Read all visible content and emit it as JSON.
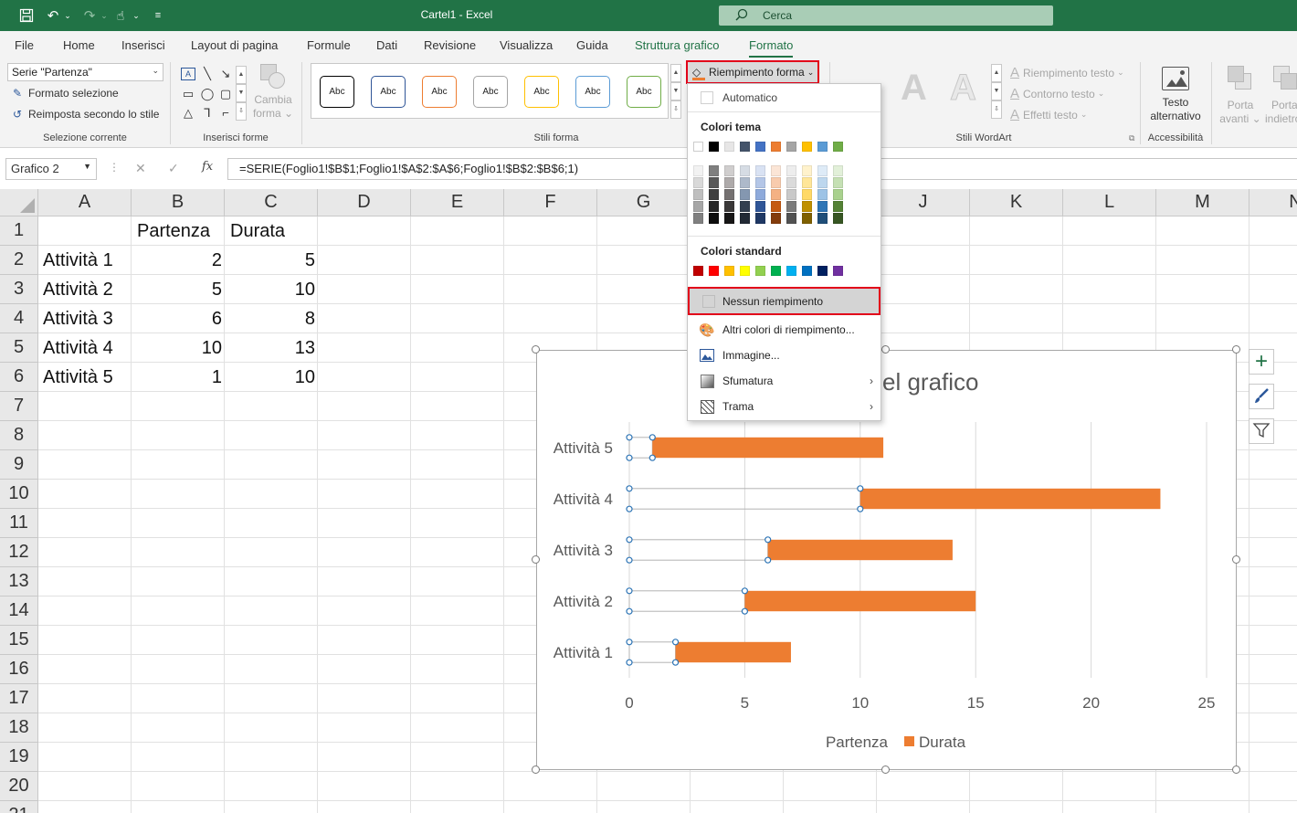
{
  "window": {
    "doc_title": "Cartel1  -  Excel",
    "search_placeholder": "Cerca",
    "colors": {
      "brand": "#217346",
      "accent": "#ED7D31",
      "highlight": "#E2001A"
    }
  },
  "tabs": [
    {
      "label": "File"
    },
    {
      "label": "Home"
    },
    {
      "label": "Inserisci"
    },
    {
      "label": "Layout di pagina"
    },
    {
      "label": "Formule"
    },
    {
      "label": "Dati"
    },
    {
      "label": "Revisione"
    },
    {
      "label": "Visualizza"
    },
    {
      "label": "Guida"
    },
    {
      "label": "Struttura grafico"
    },
    {
      "label": "Formato"
    }
  ],
  "ribbon": {
    "selection": {
      "selected_value": "Serie \"Partenza\"",
      "format_selection": "Formato selezione",
      "reset_style": "Reimposta secondo lo stile",
      "group_label": "Selezione corrente"
    },
    "insert_shapes": {
      "change_shape_l1": "Cambia",
      "change_shape_l2": "forma",
      "group_label": "Inserisci forme"
    },
    "shape_styles": {
      "chips": [
        {
          "text": "Abc",
          "color": "#000000"
        },
        {
          "text": "Abc",
          "color": "#2F5597"
        },
        {
          "text": "Abc",
          "color": "#ED7D31"
        },
        {
          "text": "Abc",
          "color": "#A5A5A5"
        },
        {
          "text": "Abc",
          "color": "#FFC000"
        },
        {
          "text": "Abc",
          "color": "#5B9BD5"
        },
        {
          "text": "Abc",
          "color": "#70AD47"
        }
      ],
      "group_label": "Stili forma"
    },
    "shape_fill_button": "Riempimento forma",
    "wordart": {
      "text_fill": "Riempimento testo",
      "text_outline": "Contorno testo",
      "text_effects": "Effetti testo",
      "group_label": "Stili WordArt"
    },
    "accessibility": {
      "alt_text_l1": "Testo",
      "alt_text_l2": "alternativo",
      "group_label": "Accessibilità"
    },
    "arrange": {
      "bring_forward_l1": "Porta",
      "bring_forward_l2": "avanti",
      "send_backward_l1": "Porta",
      "send_backward_l2": "indietro"
    }
  },
  "formula_bar": {
    "name_box": "Grafico 2",
    "fx": "fx",
    "formula": "=SERIE(Foglio1!$B$1;Foglio1!$A$2:$A$6;Foglio1!$B$2:$B$6;1)"
  },
  "sheet": {
    "columns": [
      "A",
      "B",
      "C",
      "D",
      "E",
      "F",
      "G",
      "H",
      "I",
      "J",
      "K",
      "L",
      "M",
      "N"
    ],
    "rows": [
      "1",
      "2",
      "3",
      "4",
      "5",
      "6",
      "7",
      "8",
      "9",
      "10",
      "11",
      "12",
      "13",
      "14",
      "15",
      "16",
      "17",
      "18",
      "19",
      "20",
      "21"
    ],
    "header_row": [
      "",
      "Partenza",
      "Durata"
    ],
    "data": [
      [
        "Attività 1",
        "2",
        "5"
      ],
      [
        "Attività 2",
        "5",
        "10"
      ],
      [
        "Attività 3",
        "6",
        "8"
      ],
      [
        "Attività 4",
        "10",
        "13"
      ],
      [
        "Attività 5",
        "1",
        "10"
      ]
    ]
  },
  "chart_data": {
    "type": "bar",
    "orientation": "horizontal",
    "stacked": true,
    "title": "el grafico",
    "categories": [
      "Attività 1",
      "Attività 2",
      "Attività 3",
      "Attività 4",
      "Attività 5"
    ],
    "series": [
      {
        "name": "Partenza",
        "values": [
          2,
          5,
          6,
          10,
          1
        ],
        "fill": "none"
      },
      {
        "name": "Durata",
        "values": [
          5,
          10,
          8,
          13,
          10
        ],
        "fill": "#ED7D31"
      }
    ],
    "xlim": [
      0,
      25
    ],
    "x_ticks": [
      "0",
      "5",
      "10",
      "15",
      "20",
      "25"
    ],
    "grid": true,
    "legend": "bottom"
  },
  "dropdown": {
    "automatic": "Automatico",
    "theme_colors_label": "Colori tema",
    "theme_colors": [
      "#FFFFFF",
      "#000000",
      "#E7E6E6",
      "#44546A",
      "#4472C4",
      "#ED7D31",
      "#A5A5A5",
      "#FFC000",
      "#5B9BD5",
      "#70AD47"
    ],
    "theme_shades": [
      [
        "#F2F2F2",
        "#D9D9D9",
        "#BFBFBF",
        "#A6A6A6",
        "#808080"
      ],
      [
        "#7F7F7F",
        "#595959",
        "#404040",
        "#262626",
        "#0D0D0D"
      ],
      [
        "#D0CECE",
        "#AEAAAA",
        "#757171",
        "#3A3838",
        "#171616"
      ],
      [
        "#D6DCE4",
        "#ADB9CA",
        "#8497B0",
        "#333F4F",
        "#222A35"
      ],
      [
        "#D9E2F3",
        "#B4C6E7",
        "#8EAADB",
        "#2F5597",
        "#1F3864"
      ],
      [
        "#FBE5D6",
        "#F8CBAD",
        "#F4B183",
        "#C55A11",
        "#843C0C"
      ],
      [
        "#EDEDED",
        "#DBDBDB",
        "#C9C9C9",
        "#7B7B7B",
        "#525252"
      ],
      [
        "#FFF2CC",
        "#FFE699",
        "#FFD966",
        "#BF9000",
        "#7F6000"
      ],
      [
        "#DEEBF7",
        "#BDD7EE",
        "#9DC3E6",
        "#2E75B6",
        "#1F4E79"
      ],
      [
        "#E2F0D9",
        "#C5E0B4",
        "#A9D18E",
        "#548235",
        "#375623"
      ]
    ],
    "standard_colors_label": "Colori standard",
    "standard_colors": [
      "#C00000",
      "#FF0000",
      "#FFC000",
      "#FFFF00",
      "#92D050",
      "#00B050",
      "#00B0F0",
      "#0070C0",
      "#002060",
      "#7030A0"
    ],
    "no_fill": "Nessun riempimento",
    "more_colors": "Altri colori di riempimento...",
    "picture": "Immagine...",
    "gradient": "Sfumatura",
    "texture": "Trama"
  }
}
